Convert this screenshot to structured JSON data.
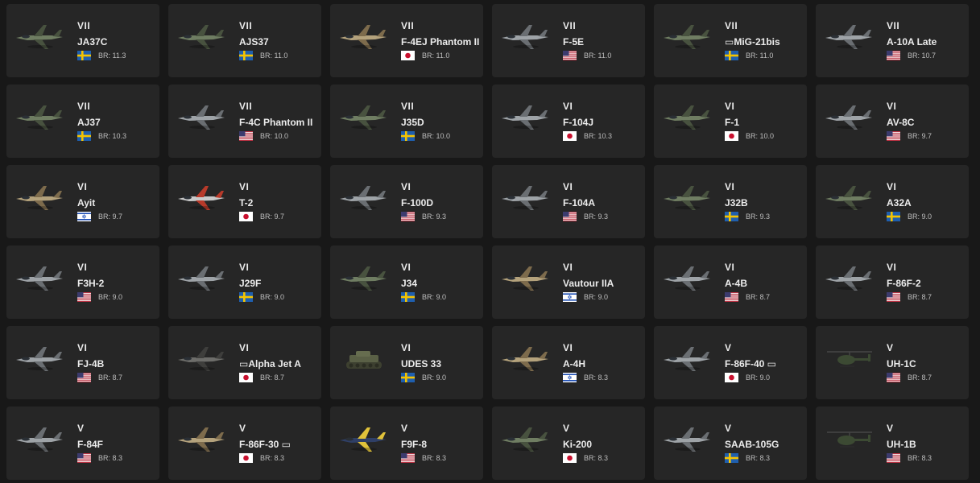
{
  "vehicles": [
    {
      "rank": "VII",
      "name": "JA37C",
      "br": "BR: 11.3",
      "nation": "sweden",
      "icon": "jet-green-icon"
    },
    {
      "rank": "VII",
      "name": "AJS37",
      "br": "BR: 11.0",
      "nation": "sweden",
      "icon": "jet-green-icon"
    },
    {
      "rank": "VII",
      "name": "F-4EJ Phantom II",
      "br": "BR: 11.0",
      "nation": "japan",
      "icon": "jet-tan-icon"
    },
    {
      "rank": "VII",
      "name": "F-5E",
      "br": "BR: 11.0",
      "nation": "usa",
      "icon": "jet-grey-icon"
    },
    {
      "rank": "VII",
      "name": "▭MiG-21bis",
      "br": "BR: 11.0",
      "nation": "sweden",
      "icon": "jet-green-icon"
    },
    {
      "rank": "VII",
      "name": "A-10A Late",
      "br": "BR: 10.7",
      "nation": "usa",
      "icon": "jet-grey-icon"
    },
    {
      "rank": "VII",
      "name": "AJ37",
      "br": "BR: 10.3",
      "nation": "sweden",
      "icon": "jet-green-icon"
    },
    {
      "rank": "VII",
      "name": "F-4C Phantom II",
      "br": "BR: 10.0",
      "nation": "usa",
      "icon": "jet-grey-icon"
    },
    {
      "rank": "VII",
      "name": "J35D",
      "br": "BR: 10.0",
      "nation": "sweden",
      "icon": "jet-green-icon"
    },
    {
      "rank": "VI",
      "name": "F-104J",
      "br": "BR: 10.3",
      "nation": "japan",
      "icon": "jet-grey-icon"
    },
    {
      "rank": "VI",
      "name": "F-1",
      "br": "BR: 10.0",
      "nation": "japan",
      "icon": "jet-green-icon"
    },
    {
      "rank": "VI",
      "name": "AV-8C",
      "br": "BR: 9.7",
      "nation": "usa",
      "icon": "jet-grey-icon"
    },
    {
      "rank": "VI",
      "name": "Ayit",
      "br": "BR: 9.7",
      "nation": "israel",
      "icon": "jet-tan-icon"
    },
    {
      "rank": "VI",
      "name": "T-2",
      "br": "BR: 9.7",
      "nation": "japan",
      "icon": "jet-red-icon"
    },
    {
      "rank": "VI",
      "name": "F-100D",
      "br": "BR: 9.3",
      "nation": "usa",
      "icon": "jet-grey-icon"
    },
    {
      "rank": "VI",
      "name": "F-104A",
      "br": "BR: 9.3",
      "nation": "usa",
      "icon": "jet-grey-icon"
    },
    {
      "rank": "VI",
      "name": "J32B",
      "br": "BR: 9.3",
      "nation": "sweden",
      "icon": "jet-green-icon"
    },
    {
      "rank": "VI",
      "name": "A32A",
      "br": "BR: 9.0",
      "nation": "sweden",
      "icon": "jet-green-icon"
    },
    {
      "rank": "VI",
      "name": "F3H-2",
      "br": "BR: 9.0",
      "nation": "usa",
      "icon": "jet-grey-icon"
    },
    {
      "rank": "VI",
      "name": "J29F",
      "br": "BR: 9.0",
      "nation": "sweden",
      "icon": "jet-grey-icon"
    },
    {
      "rank": "VI",
      "name": "J34",
      "br": "BR: 9.0",
      "nation": "sweden",
      "icon": "jet-green-icon"
    },
    {
      "rank": "VI",
      "name": "Vautour IIA",
      "br": "BR: 9.0",
      "nation": "israel",
      "icon": "jet-tan-icon"
    },
    {
      "rank": "VI",
      "name": "A-4B",
      "br": "BR: 8.7",
      "nation": "usa",
      "icon": "jet-grey-icon"
    },
    {
      "rank": "VI",
      "name": "F-86F-2",
      "br": "BR: 8.7",
      "nation": "usa",
      "icon": "jet-grey-icon"
    },
    {
      "rank": "VI",
      "name": "FJ-4B",
      "br": "BR: 8.7",
      "nation": "usa",
      "icon": "jet-grey-icon"
    },
    {
      "rank": "VI",
      "name": "▭Alpha Jet A",
      "br": "BR: 8.7",
      "nation": "japan",
      "icon": "jet-dark-icon"
    },
    {
      "rank": "VI",
      "name": "UDES 33",
      "br": "BR: 9.0",
      "nation": "sweden",
      "icon": "tank-icon"
    },
    {
      "rank": "VI",
      "name": "A-4H",
      "br": "BR: 8.3",
      "nation": "israel",
      "icon": "jet-tan-icon"
    },
    {
      "rank": "V",
      "name": "F-86F-40 ▭",
      "br": "BR: 9.0",
      "nation": "japan",
      "icon": "jet-grey-icon"
    },
    {
      "rank": "V",
      "name": "UH-1C",
      "br": "BR: 8.7",
      "nation": "usa",
      "icon": "helicopter-icon"
    },
    {
      "rank": "V",
      "name": "F-84F",
      "br": "BR: 8.3",
      "nation": "usa",
      "icon": "jet-grey-icon"
    },
    {
      "rank": "V",
      "name": "F-86F-30 ▭",
      "br": "BR: 8.3",
      "nation": "japan",
      "icon": "jet-tan-icon"
    },
    {
      "rank": "V",
      "name": "F9F-8",
      "br": "BR: 8.3",
      "nation": "usa",
      "icon": "jet-blue-icon"
    },
    {
      "rank": "V",
      "name": "Ki-200",
      "br": "BR: 8.3",
      "nation": "japan",
      "icon": "jet-green-icon"
    },
    {
      "rank": "V",
      "name": "SAAB-105G",
      "br": "BR: 8.3",
      "nation": "sweden",
      "icon": "jet-grey-icon"
    },
    {
      "rank": "V",
      "name": "UH-1B",
      "br": "BR: 8.3",
      "nation": "usa",
      "icon": "helicopter-icon"
    }
  ],
  "colors": {
    "background": "#181818",
    "card": "#262626",
    "text": "#ececec",
    "br_text": "#bdbdbd"
  }
}
